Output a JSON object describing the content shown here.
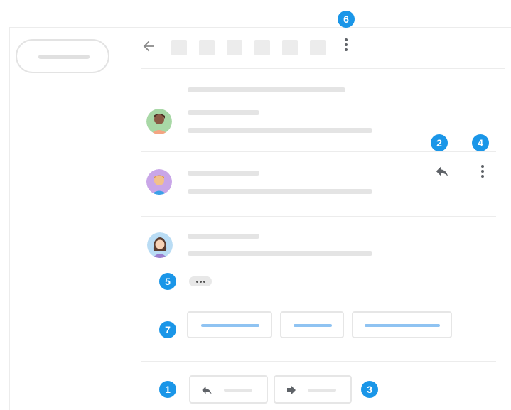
{
  "badges": {
    "reply_all_button": "1",
    "reply_icon": "2",
    "forward_button": "3",
    "message_more": "4",
    "expand_pill": "5",
    "thread_more": "6",
    "smart_replies": "7"
  },
  "icons": {
    "back": "back-arrow-icon",
    "reply": "reply-icon",
    "forward": "forward-icon",
    "more": "more-vert-icon",
    "expand": "more-horiz-icon"
  },
  "colors": {
    "badge": "#1a96e8",
    "smart_reply_line": "#8fc3f2",
    "placeholder": "#e4e4e4",
    "icon": "#5f6368"
  }
}
